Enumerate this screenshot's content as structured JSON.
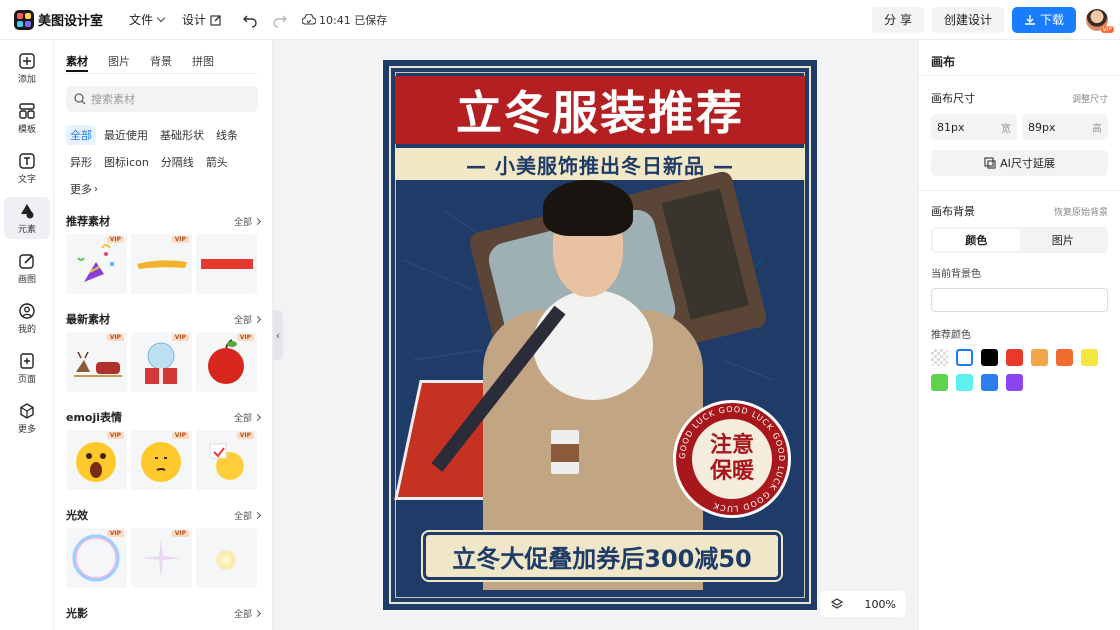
{
  "app": {
    "name": "美图设计室"
  },
  "topbar": {
    "file_menu": "文件",
    "design_menu": "设计",
    "save_status": "10:41 已保存",
    "share_label": "分 享",
    "create_label": "创建设计",
    "download_label": "下载",
    "avatar_badge": "VIP"
  },
  "rail": [
    {
      "label": "添加",
      "icon": "plus-square-icon"
    },
    {
      "label": "模板",
      "icon": "template-icon"
    },
    {
      "label": "文字",
      "icon": "text-icon"
    },
    {
      "label": "元素",
      "icon": "shapes-icon"
    },
    {
      "label": "画图",
      "icon": "pencil-icon"
    },
    {
      "label": "我的",
      "icon": "user-icon"
    },
    {
      "label": "页面",
      "icon": "page-add-icon"
    },
    {
      "label": "更多",
      "icon": "cube-icon"
    }
  ],
  "panel": {
    "tabs": [
      "素材",
      "图片",
      "背景",
      "拼图"
    ],
    "search_placeholder": "搜索素材",
    "chips": [
      "全部",
      "最近使用",
      "基础形状",
      "线条",
      "异形",
      "图标icon",
      "分隔线",
      "箭头",
      "更多"
    ],
    "see_all": "全部",
    "vip": "VIP",
    "sections": [
      {
        "title": "推荐素材"
      },
      {
        "title": "最新素材"
      },
      {
        "title": "emoji表情"
      },
      {
        "title": "光效"
      },
      {
        "title": "光影"
      }
    ]
  },
  "poster": {
    "title": "立冬服装推荐",
    "subtitle": "— 小美服饰推出冬日新品 —",
    "stamp_line1": "注意",
    "stamp_line2": "保暖",
    "stamp_ring": "GOOD LUCK  GOOD LUCK  GOOD LUCK  GOOD LUCK",
    "promo": "立冬大促叠加券后300减50"
  },
  "zoom": {
    "level": "100%"
  },
  "right_panel": {
    "title": "画布",
    "size_label": "画布尺寸",
    "adjust_size": "调整尺寸",
    "width_value": "81px",
    "width_unit": "宽",
    "height_value": "89px",
    "height_unit": "高",
    "ai_extend": "AI尺寸延展",
    "bg_label": "画布背景",
    "restore_bg": "恢复原始背景",
    "bg_tab_color": "颜色",
    "bg_tab_image": "图片",
    "current_bg": "当前背景色",
    "recommended": "推荐颜色",
    "colors": [
      "transparent",
      "#ffffff",
      "#000000",
      "#e8392a",
      "#f2a64a",
      "#ef6b2f",
      "#f5e73d",
      "#5fd14a",
      "#5ef0ee",
      "#2c7df0",
      "#8c45f0"
    ]
  }
}
